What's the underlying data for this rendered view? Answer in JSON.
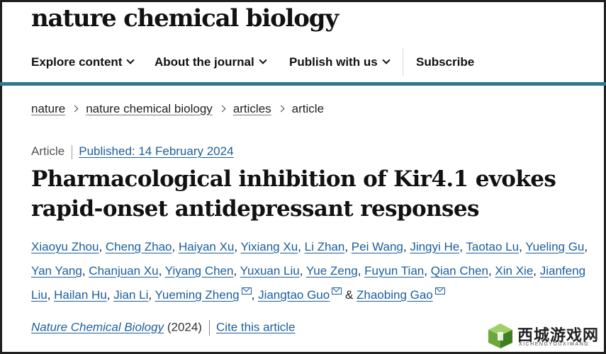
{
  "masthead": "nature chemical biology",
  "nav": {
    "explore": "Explore content",
    "about": "About the journal",
    "publish": "Publish with us",
    "subscribe": "Subscribe"
  },
  "breadcrumb": [
    "nature",
    "nature chemical biology",
    "articles",
    "article"
  ],
  "meta": {
    "type": "Article",
    "published": "Published: 14 February 2024"
  },
  "title": "Pharmacological inhibition of Kir4.1 evokes rapid-onset antidepressant responses",
  "authors": [
    "Xiaoyu Zhou",
    "Cheng Zhao",
    "Haiyan Xu",
    "Yixiang Xu",
    "Li Zhan",
    "Pei Wang",
    "Jingyi He",
    "Taotao Lu",
    "Yueling Gu",
    "Yan Yang",
    "Chanjuan Xu",
    "Yiyang Chen",
    "Yuxuan Liu",
    "Yue Zeng",
    "Fuyun Tian",
    "Qian Chen",
    "Xin Xie",
    "Jianfeng Liu",
    "Hailan Hu",
    "Jian Li",
    "Yueming Zheng",
    "Jiangtao Guo",
    "Zhaobing Gao"
  ],
  "authors_separator": ", ",
  "authors_last_join": " & ",
  "citation": {
    "journal": "Nature Chemical Biology",
    "year": "(2024)",
    "cite_label": "Cite this article"
  },
  "watermark": {
    "text": "西城游戏网",
    "sub": "XICHENGYOUXIWANG"
  },
  "colors": {
    "accent_rule": "#2b7a8c",
    "link": "#1a5f9e"
  }
}
